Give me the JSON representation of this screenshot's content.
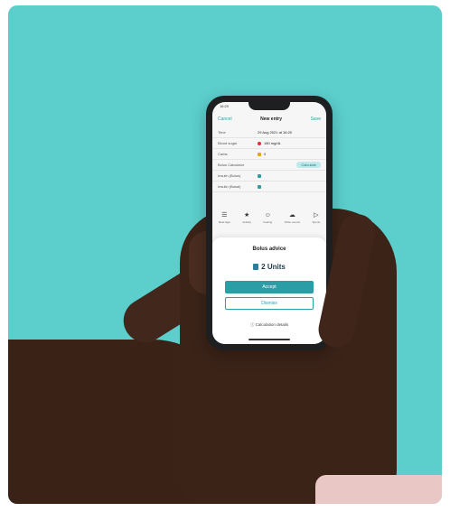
{
  "phone": {
    "status_time": "16:20",
    "nav": {
      "cancel": "Cancel",
      "title": "New entry",
      "save": "Save"
    },
    "rows": [
      {
        "label": "Time",
        "value": "29 Aug 2021 at 16:20"
      },
      {
        "label": "Blood sugar",
        "value": "180 mg/dL",
        "dot_color": "#e0312f"
      },
      {
        "label": "Carbs",
        "value": "0",
        "dot_color": "#e8a21c"
      },
      {
        "label": "Bolus Calculator",
        "button": "Calculate"
      },
      {
        "label": "Insulin (Bolus)",
        "value": "",
        "dot_color": "#2b9ea5"
      },
      {
        "label": "Insulin (Basal)",
        "value": "",
        "dot_color": "#2b9ea5"
      }
    ],
    "icons": [
      {
        "name": "meal-tags-icon",
        "caption": "Meal tags"
      },
      {
        "name": "activity-icon",
        "caption": "Activity"
      },
      {
        "name": "feeling-icon",
        "caption": "Feeling"
      },
      {
        "name": "other-events-icon",
        "caption": "Other events"
      },
      {
        "name": "sports-icon",
        "caption": "Sports"
      }
    ],
    "sheet": {
      "title": "Bolus advice",
      "dose": "2 Units",
      "accept": "Accept",
      "dismiss": "Dismiss",
      "details": "Calculation details"
    }
  },
  "colors": {
    "background": "#5ccfcd",
    "accent": "#2b9ea5"
  }
}
